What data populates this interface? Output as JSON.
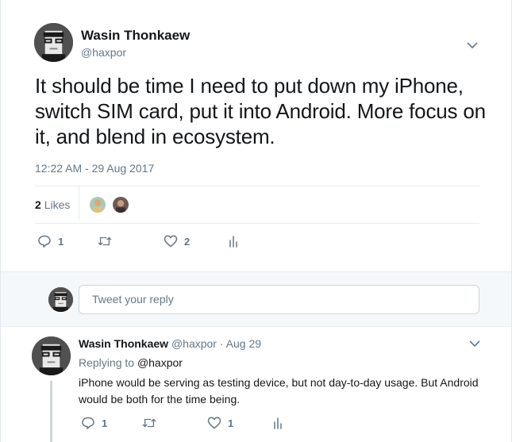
{
  "tweet": {
    "author_name": "Wasin Thonkaew",
    "author_handle": "@haxpor",
    "text": "It should be time I need to put down my iPhone, switch SIM card, put it into Android. More focus on it, and blend in ecosystem.",
    "timestamp": "12:22 AM - 29 Aug 2017",
    "likes_count": "2",
    "likes_label": "Likes",
    "actions": {
      "reply_count": "1",
      "retweet_count": "",
      "like_count": "2"
    }
  },
  "reply_box": {
    "placeholder": "Tweet your reply"
  },
  "reply": {
    "author_name": "Wasin Thonkaew",
    "author_handle": "@haxpor",
    "date": "· Aug 29",
    "replying_to_label": "Replying to",
    "replying_to_handle": "@haxpor",
    "text": "iPhone would be serving as testing device, but not day-to-day usage. But Android would be both for the time being.",
    "actions": {
      "reply_count": "1",
      "retweet_count": "",
      "like_count": "1"
    }
  },
  "colors": {
    "secondary_text": "#657786",
    "border": "#e6ecf0",
    "reply_bg": "#f5f8fa"
  }
}
